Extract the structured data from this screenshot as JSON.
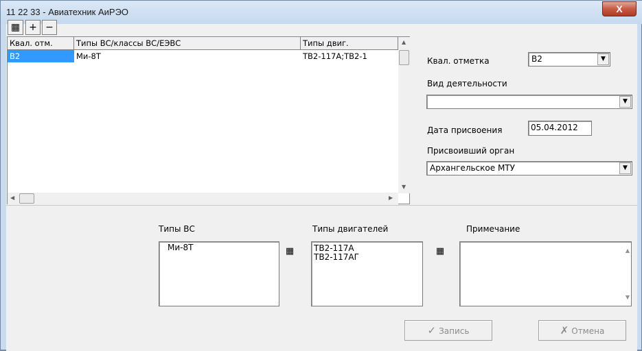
{
  "window": {
    "title": "11 22 33 - Авиатехник  АиРЭО",
    "close_glyph": "X"
  },
  "toolbar": {
    "report_icon": "▦",
    "add_icon": "+",
    "remove_icon": "−"
  },
  "grid": {
    "columns": [
      "Квал. отм.",
      "Типы ВС/классы ВС/ЕЭВС",
      "Типы двиг."
    ],
    "rows": [
      {
        "qual": "В2",
        "types": "Ми-8Т",
        "engines": "ТВ2-117А;ТВ2-1"
      }
    ]
  },
  "details": {
    "qual_label": "Квал. отметка",
    "qual_value": "В2",
    "activity_label": "Вид деятельности",
    "activity_value": "",
    "date_label": "Дата присвоения",
    "date_value": "05.04.2012",
    "authority_label": "Присвоивший орган",
    "authority_value": "Архангельское МТУ"
  },
  "lists": {
    "aircraft_label": "Типы ВС",
    "aircraft_items": [
      "Ми-8Т"
    ],
    "engines_label": "Типы двигателей",
    "engines_items": [
      "ТВ2-117А",
      "ТВ2-117АГ"
    ],
    "note_label": "Примечание",
    "note_value": ""
  },
  "buttons": {
    "save_label": "Запись",
    "save_icon": "✓",
    "cancel_label": "Отмена",
    "cancel_icon": "✗"
  }
}
